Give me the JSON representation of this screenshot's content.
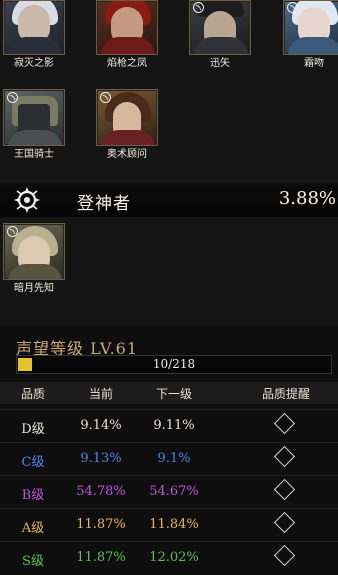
{
  "characters_row1": [
    {
      "name": "寂灭之影"
    },
    {
      "name": "焰枪之凤"
    },
    {
      "name": "迅矢"
    },
    {
      "name": "霜吻"
    }
  ],
  "characters_row2": [
    {
      "name": "王国骑士"
    },
    {
      "name": "奥术顾问"
    }
  ],
  "tier": {
    "name": "登神者",
    "rate": "3.88%",
    "characters": [
      {
        "name": "暗月先知"
      }
    ]
  },
  "reputation": {
    "title": "声望等级 LV.61",
    "progress_text": "10/218",
    "progress_fraction": 0.046
  },
  "table": {
    "headers": [
      "品质",
      "当前",
      "下一级",
      "品质提醒"
    ],
    "rows": [
      {
        "grade": "D级",
        "current": "9.14%",
        "next": "9.11%",
        "color": "#e8e2d6"
      },
      {
        "grade": "C级",
        "current": "9.13%",
        "next": "9.1%",
        "color": "#4f86e8"
      },
      {
        "grade": "B级",
        "current": "54.78%",
        "next": "54.67%",
        "color": "#c155d9"
      },
      {
        "grade": "A级",
        "current": "11.87%",
        "next": "11.84%",
        "color": "#e9b45a"
      },
      {
        "grade": "S级",
        "current": "11.87%",
        "next": "12.02%",
        "color": "#59c34c"
      }
    ]
  }
}
